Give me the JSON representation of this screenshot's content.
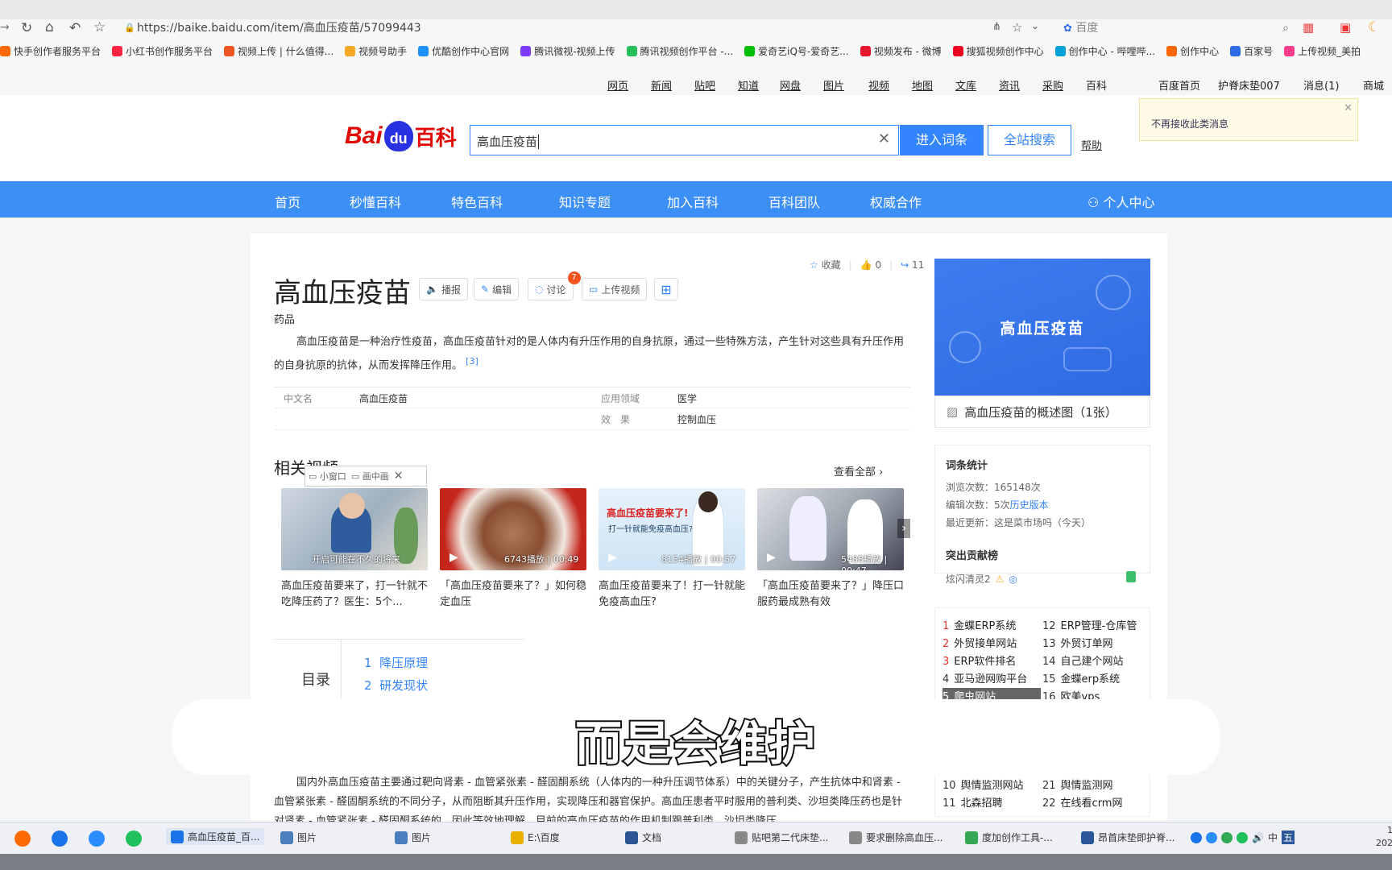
{
  "browser": {
    "url": "https://baike.baidu.com/item/高血压疫苗/57099443",
    "search_engine": "百度",
    "bookmarks": [
      {
        "label": "快手创作者服务平台",
        "color": "#ff6a00"
      },
      {
        "label": "小红书创作服务平台",
        "color": "#ff2442"
      },
      {
        "label": "视频上传 | 什么值得...",
        "color": "#e52"
      },
      {
        "label": "视频号助手",
        "color": "#f5a623"
      },
      {
        "label": "优酷创作中心官网",
        "color": "#1e90ff"
      },
      {
        "label": "腾讯微视-视频上传",
        "color": "#7b3cff"
      },
      {
        "label": "腾讯视频创作平台 -...",
        "color": "#25c05a"
      },
      {
        "label": "爱奇艺iQ号-爱奇艺...",
        "color": "#00be06"
      },
      {
        "label": "视频发布 - 微博",
        "color": "#e6162d"
      },
      {
        "label": "搜狐视频创作中心",
        "color": "#e02"
      },
      {
        "label": "创作中心 - 哔哩哔...",
        "color": "#00a1d6"
      },
      {
        "label": "创作中心",
        "color": "#f60"
      },
      {
        "label": "百家号",
        "color": "#2e6be6"
      },
      {
        "label": "上传视频_美拍",
        "color": "#ff3c8c"
      }
    ]
  },
  "baidu_topnav": {
    "links": [
      "网页",
      "新闻",
      "贴吧",
      "知道",
      "网盘",
      "图片",
      "视频",
      "地图",
      "文库",
      "资讯",
      "采购",
      "百科"
    ],
    "right": [
      "百度首页",
      "护脊床垫007",
      "消息(1)",
      "商城"
    ]
  },
  "header": {
    "logo_bai": "Bai",
    "logo_du": "du",
    "logo_baike": "百科",
    "search_value": "高血压疫苗",
    "enter_label": "进入词条",
    "site_search_label": "全站搜索",
    "help_label": "帮助",
    "notice": "不再接收此类消息"
  },
  "bluenav": [
    "首页",
    "秒懂百科",
    "特色百科",
    "知识专题",
    "加入百科",
    "百科团队",
    "权威合作"
  ],
  "bluenav_user": "个人中心",
  "entry": {
    "title": "高血压疫苗",
    "category": "药品",
    "actions": {
      "play": "播报",
      "edit": "编辑",
      "discuss": "讨论",
      "discuss_badge": "7",
      "upload": "上传视频"
    },
    "collect": "收藏",
    "likes": "0",
    "shares": "11",
    "summary": "高血压疫苗是一种治疗性疫苗，高血压疫苗针对的是人体内有升压作用的自身抗原，通过一些特殊方法，产生针对这些具有升压作用的自身抗原的抗体，从而发挥降压作用。",
    "summary_ref": "[3]",
    "infobox": [
      {
        "label": "中文名",
        "value": "高血压疫苗"
      },
      {
        "label": "应用领域",
        "value": "医学"
      },
      {
        "label": "效　果",
        "value": "控制血压"
      }
    ]
  },
  "videos": {
    "heading": "相关视频",
    "view_all": "查看全部",
    "mini_window": "小窗口",
    "pip": "画中画",
    "items": [
      {
        "overlay": "开启可能在不久的将来",
        "stats": "",
        "caption": "高血压疫苗要来了，打一针就不吃降压药了？医生：5个..."
      },
      {
        "overlay": "",
        "stats": "6743播放 | 00:49",
        "caption": "「高血压疫苗要来了？」如何稳定血压"
      },
      {
        "overlay": "高血压疫苗要来了!",
        "overlay2": "打一针就能免疫高血压?",
        "stats": "8154播放 | 00:57",
        "caption": "高血压疫苗要来了！打一针就能免疫高血压?"
      },
      {
        "overlay": "",
        "stats": "5488播放 | 00:47",
        "caption": "「高血压疫苗要来了？」降压口服药最成熟有效"
      }
    ]
  },
  "toc": {
    "label": "目录",
    "items": [
      {
        "num": "1",
        "text": "降压原理"
      },
      {
        "num": "2",
        "text": "研发现状"
      }
    ]
  },
  "body_text": "国内外高血压疫苗主要通过靶向肾素 - 血管紧张素 - 醛固酮系统（人体内的一种升压调节体系）中的关键分子，产生抗体中和肾素 - 血管紧张素 - 醛固酮系统的不同分子，从而阻断其升压作用，实现降压和器官保护。高血压患者平时服用的普利类、沙坦类降压药也是针对肾素 - 血管紧张素 - 醛固酮系统的，因此等效地理解，目前的高血压疫苗的作用机制跟普利类、沙坦类降压",
  "sidebar": {
    "cover_title": "高血压疫苗",
    "cover_caption": "高血压疫苗的概述图（1张）",
    "stats_title": "词条统计",
    "views": "浏览次数：165148次",
    "edits_prefix": "编辑次数：5次",
    "edits_link": "历史版本",
    "last_update": "最近更新：这是菜市场吗（今天）",
    "contributors_title": "突出贡献榜",
    "contributor": "炫闪清灵2",
    "ranking": [
      {
        "n": "1",
        "t": "金蝶ERP系统"
      },
      {
        "n": "12",
        "t": "ERP管理-仓库管"
      },
      {
        "n": "2",
        "t": "外贸接单网站"
      },
      {
        "n": "13",
        "t": "外贸订单网"
      },
      {
        "n": "3",
        "t": "ERP软件排名"
      },
      {
        "n": "14",
        "t": "自己建个网站"
      },
      {
        "n": "4",
        "t": "亚马逊网购平台"
      },
      {
        "n": "15",
        "t": "金蝶erp系统"
      },
      {
        "n": "5",
        "t": "爬虫网站"
      },
      {
        "n": "16",
        "t": "欧美vps"
      },
      {
        "n": "10",
        "t": "舆情监测网站"
      },
      {
        "n": "21",
        "t": "舆情监测网"
      },
      {
        "n": "11",
        "t": "北森招聘"
      },
      {
        "n": "22",
        "t": "在线看crm网"
      }
    ]
  },
  "subtitle": "而是会维护",
  "taskbar": {
    "items": [
      "高血压疫苗_百...",
      "图片",
      "图片",
      "E:\\百度",
      "文档",
      "贴吧第二代床垫...",
      "要求删除高血压...",
      "度加创作工具-...",
      "昂首床垫即护脊..."
    ],
    "ime": "中",
    "ime2": "五",
    "clock": "1",
    "year": "202"
  }
}
